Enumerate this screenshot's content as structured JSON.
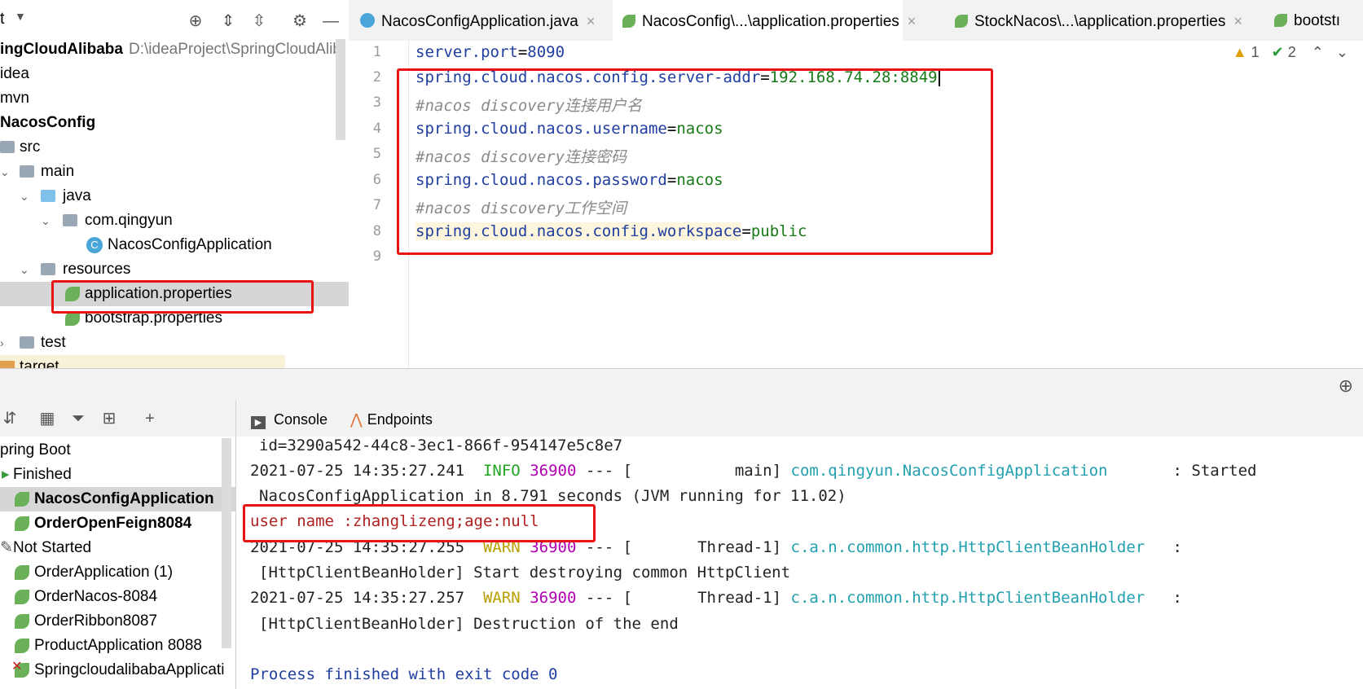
{
  "project": {
    "header_fragment": "t",
    "root_name": "ingCloudAlibaba",
    "root_path": "D:\\ideaProject\\SpringCloudAlib",
    "items": [
      {
        "label": "idea"
      },
      {
        "label": "mvn"
      },
      {
        "label": "NacosConfig"
      },
      {
        "label": "src"
      },
      {
        "label": "main"
      },
      {
        "label": "java"
      },
      {
        "label": "com.qingyun"
      },
      {
        "label": "NacosConfigApplication"
      },
      {
        "label": "resources"
      },
      {
        "label": "application.properties"
      },
      {
        "label": "bootstrap.properties"
      },
      {
        "label": "test"
      },
      {
        "label": "target"
      }
    ]
  },
  "editor": {
    "tabs": [
      {
        "label": "NacosConfigApplication.java"
      },
      {
        "label": "NacosConfig\\...\\application.properties"
      },
      {
        "label": "StockNacos\\...\\application.properties"
      },
      {
        "label": "bootstı"
      }
    ],
    "inspections": {
      "warnings": "1",
      "checks": "2"
    },
    "line_numbers": [
      "1",
      "2",
      "3",
      "4",
      "5",
      "6",
      "7",
      "8",
      "9"
    ],
    "lines": [
      {
        "key": "server.port",
        "eq": "=",
        "val": "8090"
      },
      {
        "key": "spring.cloud.nacos.config.server-addr",
        "eq": "=",
        "val": "192.168.74.28:8849"
      },
      {
        "comment": "#nacos discovery连接用户名"
      },
      {
        "key": "spring.cloud.nacos.username",
        "eq": "=",
        "val": "nacos"
      },
      {
        "comment": "#nacos discovery连接密码"
      },
      {
        "key": "spring.cloud.nacos.password",
        "eq": "=",
        "val": "nacos"
      },
      {
        "comment": "#nacos discovery工作空间"
      },
      {
        "key": "spring.cloud.nacos.config.workspace",
        "eq": "=",
        "val": "public"
      }
    ]
  },
  "services": {
    "items": [
      {
        "label": "pring Boot"
      },
      {
        "label": "Finished"
      },
      {
        "label": "NacosConfigApplication"
      },
      {
        "label": "OrderOpenFeign8084"
      },
      {
        "label": "Not Started"
      },
      {
        "label": "OrderApplication (1)"
      },
      {
        "label": "OrderNacos-8084"
      },
      {
        "label": "OrderRibbon8087"
      },
      {
        "label": "ProductApplication 8088"
      },
      {
        "label": "SpringcloudalibabaApplicati"
      }
    ]
  },
  "console": {
    "tabs": [
      {
        "label": "Console"
      },
      {
        "label": "Endpoints"
      }
    ],
    "lines": {
      "l0": "id=3290a542-44c8-3ec1-866f-954147e5c8e7",
      "l1_time": "2021-07-25 14:35:27.241  ",
      "l1_level": "INFO",
      "l1_pid": "36900",
      "l1_mid": " --- [           main] ",
      "l1_cls": "com.qingyun.NacosConfigApplication",
      "l1_end": "       : Started",
      "l2": "NacosConfigApplication in 8.791 seconds (JVM running for 11.02)",
      "l3": "user name :zhanglizeng;age:null",
      "l4_time": "2021-07-25 14:35:27.255  ",
      "l4_level": "WARN",
      "l4_pid": "36900",
      "l4_mid": " --- [       Thread-1] ",
      "l4_cls": "c.a.n.common.http.HttpClientBeanHolder",
      "l4_end": "   :",
      "l5": "[HttpClientBeanHolder] Start destroying common HttpClient",
      "l6_time": "2021-07-25 14:35:27.257  ",
      "l6_level": "WARN",
      "l6_pid": "36900",
      "l6_mid": " --- [       Thread-1] ",
      "l6_cls": "c.a.n.common.http.HttpClientBeanHolder",
      "l6_end": "   :",
      "l7": "[HttpClientBeanHolder] Destruction of the end",
      "l8": "Process finished with exit code 0"
    }
  },
  "colors": {
    "highlight_box": "#e81414",
    "key": "#1f3ea0",
    "value": "#177a17",
    "comment": "#8a8a8a"
  }
}
